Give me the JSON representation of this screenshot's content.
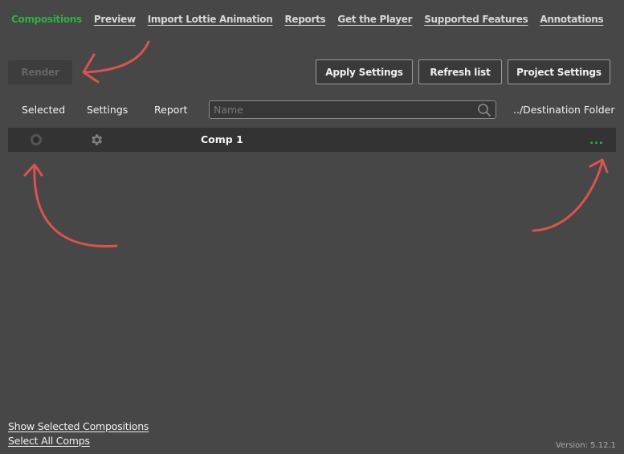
{
  "nav": {
    "items": [
      {
        "label": "Compositions",
        "active": true
      },
      {
        "label": "Preview"
      },
      {
        "label": "Import Lottie Animation"
      },
      {
        "label": "Reports"
      },
      {
        "label": "Get the Player"
      },
      {
        "label": "Supported Features"
      },
      {
        "label": "Annotations"
      }
    ]
  },
  "toolbar": {
    "render_label": "Render",
    "apply_label": "Apply Settings",
    "refresh_label": "Refresh list",
    "project_label": "Project Settings"
  },
  "columns": {
    "selected": "Selected",
    "settings": "Settings",
    "report": "Report",
    "destination": "../Destination Folder"
  },
  "search": {
    "placeholder": "Name",
    "value": ""
  },
  "comps": [
    {
      "name": "Comp 1",
      "more": "..."
    }
  ],
  "footer": {
    "show_selected": "Show Selected Compositions",
    "select_all": "Select All Comps",
    "version": "Version: 5.12.1"
  },
  "colors": {
    "accent": "#2fb044",
    "annotation_arrow": "#d9534f",
    "background": "#474747"
  },
  "icons": [
    "search-icon",
    "gear-icon",
    "radio-icon",
    "more-icon",
    "annotation-arrow"
  ]
}
